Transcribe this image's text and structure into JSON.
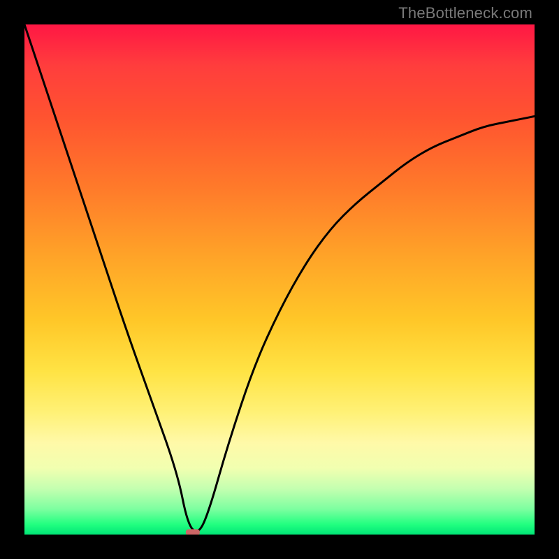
{
  "watermark": "TheBottleneck.com",
  "chart_data": {
    "type": "line",
    "title": "",
    "xlabel": "",
    "ylabel": "",
    "xlim": [
      0,
      100
    ],
    "ylim": [
      0,
      100
    ],
    "grid": false,
    "legend": false,
    "background": {
      "type": "vertical_gradient",
      "top_color": "#ff1744",
      "mid_color": "#ffd740",
      "bottom_color": "#00e676"
    },
    "series": [
      {
        "name": "bottleneck-curve",
        "color": "#000000",
        "x": [
          0,
          5,
          10,
          15,
          20,
          25,
          30,
          32,
          34,
          36,
          40,
          45,
          50,
          55,
          60,
          65,
          70,
          75,
          80,
          85,
          90,
          95,
          100
        ],
        "y": [
          100,
          85,
          70,
          55,
          40,
          26,
          12,
          2,
          0,
          4,
          18,
          33,
          44,
          53,
          60,
          65,
          69,
          73,
          76,
          78,
          80,
          81,
          82
        ]
      }
    ],
    "marker": {
      "x": 33,
      "y": 0.5,
      "color": "#cc6666",
      "shape": "pill"
    }
  }
}
